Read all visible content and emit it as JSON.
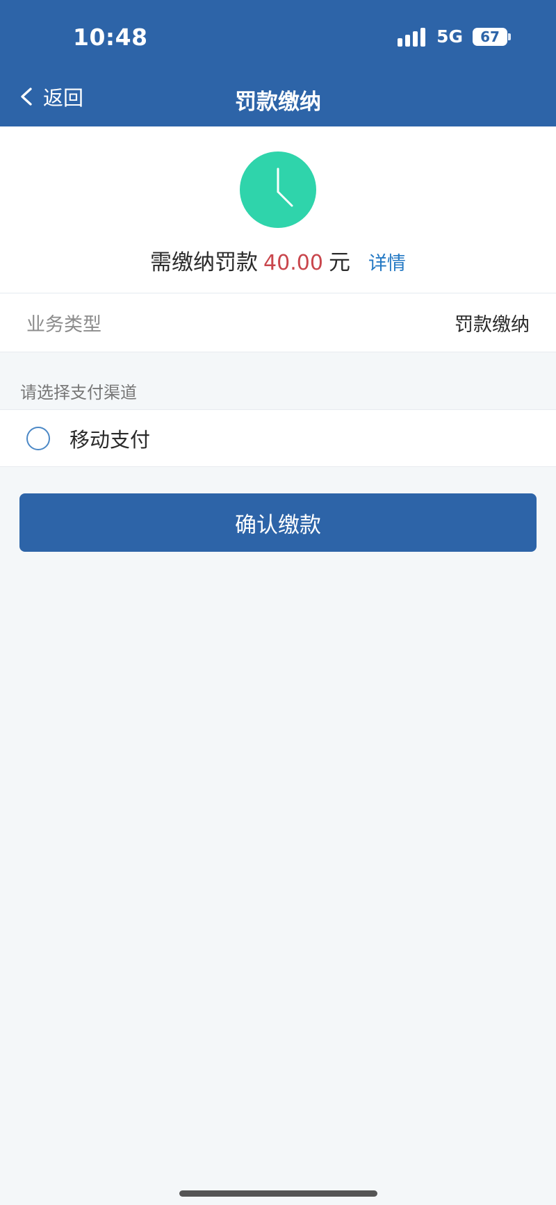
{
  "status_bar": {
    "time": "10:48",
    "network": "5G",
    "battery": "67",
    "icons": [
      "signal-icon",
      "battery-icon"
    ]
  },
  "header": {
    "back_label": "返回",
    "title": "罚款缴纳",
    "icons": [
      "back-chevron-icon"
    ]
  },
  "summary": {
    "prefix": "需缴纳罚款",
    "amount": "40.00",
    "unit": "元",
    "detail_label": "详情",
    "icon": "clock-icon",
    "colors": {
      "amount": "#c9464c",
      "detail": "#2479c4",
      "clock": "#2fd4ab"
    }
  },
  "business": {
    "label": "业务类型",
    "value": "罚款缴纳"
  },
  "payment": {
    "section_label": "请选择支付渠道",
    "options": [
      {
        "label": "移动支付",
        "selected": false,
        "icon": "radio-button-icon"
      }
    ]
  },
  "actions": {
    "confirm_label": "确认缴款"
  },
  "theme": {
    "primary": "#2d64a8",
    "background": "#f4f7f9"
  }
}
